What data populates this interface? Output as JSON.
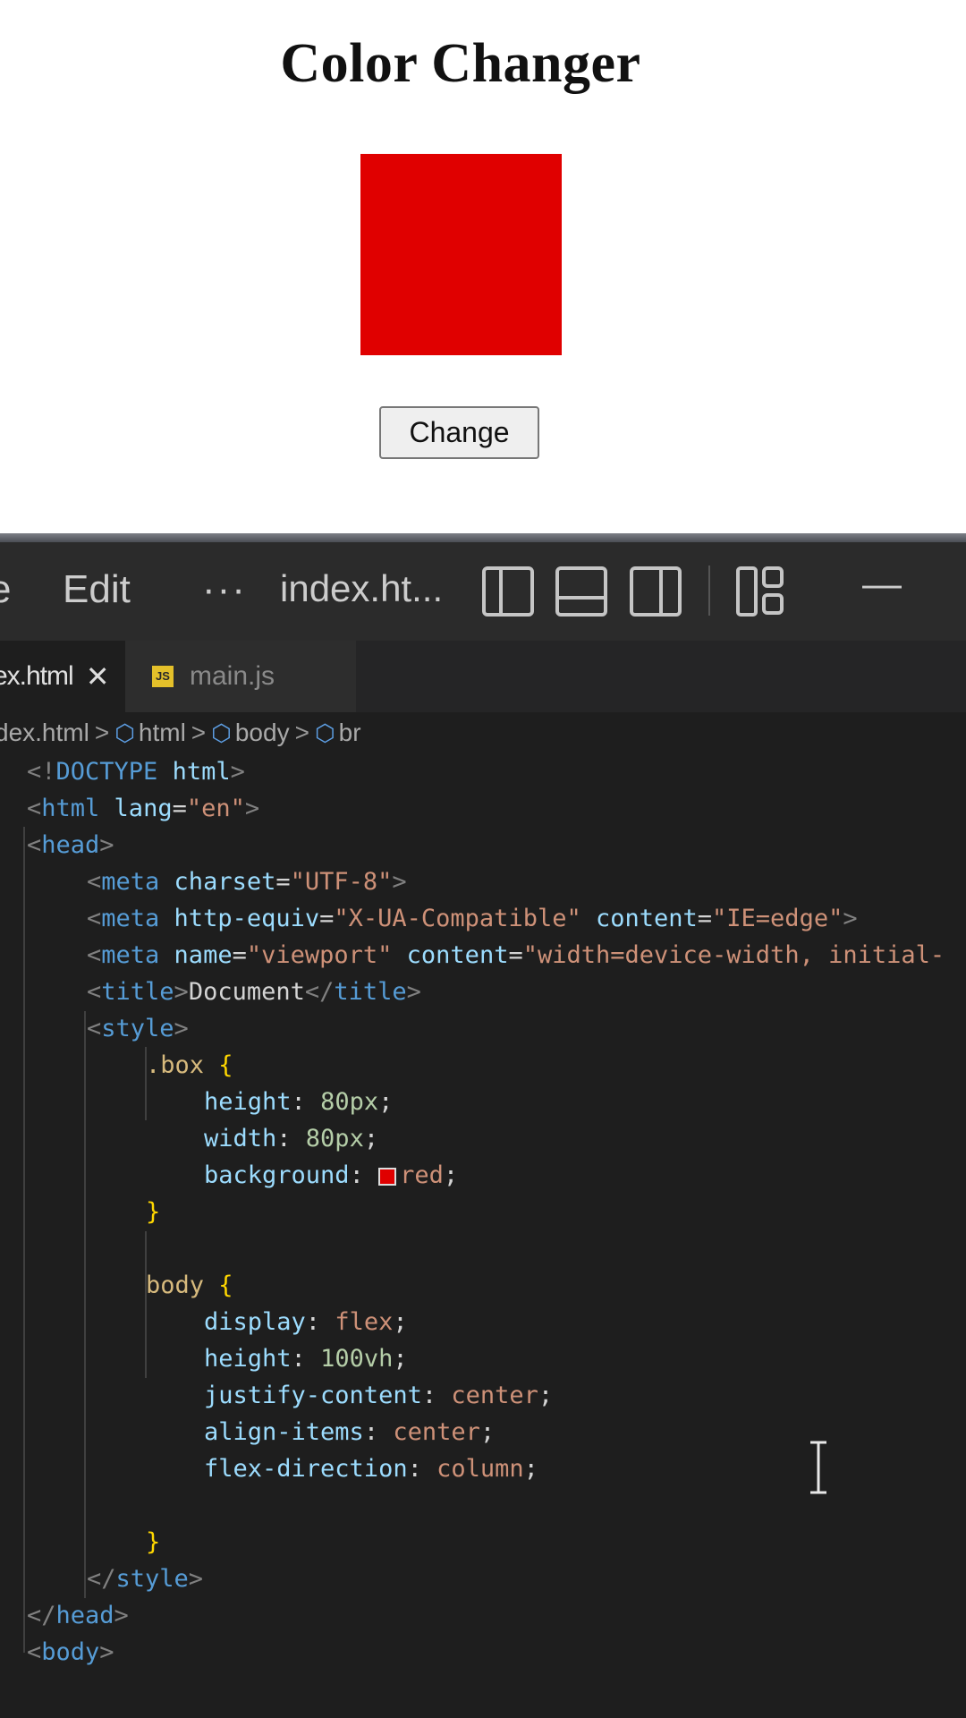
{
  "preview": {
    "heading": "Color Changer",
    "box_color": "#e00000",
    "button_label": "Change"
  },
  "editor": {
    "titlebar": {
      "menu_partial": "e",
      "edit_label": "Edit",
      "more_label": "···",
      "window_title": "index.ht...",
      "minimize_label": "—"
    },
    "tabs": [
      {
        "label": "ex.html",
        "close": "✕"
      },
      {
        "label": "main.js",
        "icon": "JS"
      }
    ],
    "breadcrumb": {
      "items": [
        "dex.html",
        "html",
        "body",
        "br"
      ],
      "separator": ">"
    },
    "code": {
      "l1_open": "<!",
      "l1_doctype": "DOCTYPE",
      "l1_html": " html",
      "l1_close": ">",
      "l2_open": "<",
      "l2_tag": "html",
      "l2_attr": " lang",
      "l2_eq": "=",
      "l2_val": "\"en\"",
      "l2_close": ">",
      "l3_open": "<",
      "l3_tag": "head",
      "l3_close": ">",
      "l4_open": "<",
      "l4_tag": "meta",
      "l4_attr": " charset",
      "l4_eq": "=",
      "l4_val": "\"UTF-8\"",
      "l4_close": ">",
      "l5_open": "<",
      "l5_tag": "meta",
      "l5_attr1": " http-equiv",
      "l5_eq1": "=",
      "l5_val1": "\"X-UA-Compatible\"",
      "l5_attr2": " content",
      "l5_eq2": "=",
      "l5_val2": "\"IE=edge\"",
      "l5_close": ">",
      "l6_open": "<",
      "l6_tag": "meta",
      "l6_attr1": " name",
      "l6_eq1": "=",
      "l6_val1": "\"viewport\"",
      "l6_attr2": " content",
      "l6_eq2": "=",
      "l6_val2": "\"width=device-width, initial-",
      "l7_open": "<",
      "l7_tag": "title",
      "l7_mid": ">",
      "l7_text": "Document",
      "l7_close_open": "</",
      "l7_close_tag": "title",
      "l7_close": ">",
      "l8_open": "<",
      "l8_tag": "style",
      "l8_close": ">",
      "l9_selector": ".box",
      "l9_brace": " {",
      "l10_prop": "height",
      "l10_colon": ": ",
      "l10_num": "80px",
      "l10_semi": ";",
      "l11_prop": "width",
      "l11_colon": ": ",
      "l11_num": "80px",
      "l11_semi": ";",
      "l12_prop": "background",
      "l12_colon": ": ",
      "l12_swatch_color": "#e00000",
      "l12_val": "red",
      "l12_semi": ";",
      "l13_brace": "}",
      "l15_selector": "body",
      "l15_brace": " {",
      "l16_prop": "display",
      "l16_colon": ": ",
      "l16_val": "flex",
      "l16_semi": ";",
      "l17_prop": "height",
      "l17_colon": ": ",
      "l17_num": "100vh",
      "l17_semi": ";",
      "l18_prop": "justify-content",
      "l18_colon": ": ",
      "l18_val": "center",
      "l18_semi": ";",
      "l19_prop": "align-items",
      "l19_colon": ": ",
      "l19_val": "center",
      "l19_semi": ";",
      "l20_prop": "flex-direction",
      "l20_colon": ": ",
      "l20_val": "column",
      "l20_semi": ";",
      "l22_brace": "}",
      "l23_open": "</",
      "l23_tag": "style",
      "l23_close": ">",
      "l24_open": "</",
      "l24_tag": "head",
      "l24_close": ">",
      "l25_open": "<",
      "l25_tag": "body",
      "l25_close": ">"
    }
  }
}
